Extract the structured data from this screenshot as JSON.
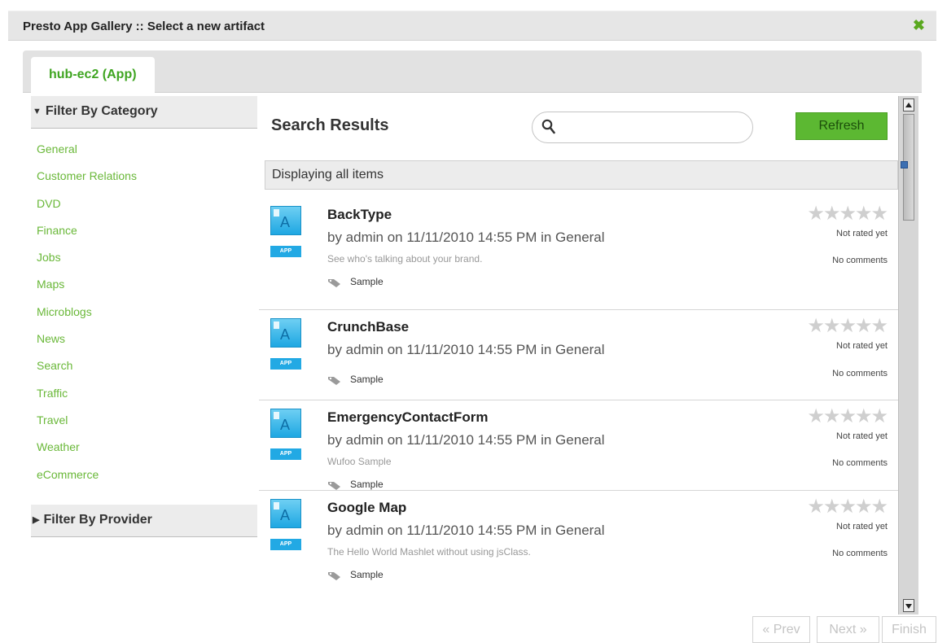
{
  "window": {
    "title": "Presto App Gallery :: Select a new artifact",
    "close_label": "✖"
  },
  "tabs": [
    {
      "label": "hub-ec2 (App)"
    }
  ],
  "sidebar": {
    "category_header": "Filter By Category",
    "categories": [
      "General",
      "Customer Relations",
      "DVD",
      "Finance",
      "Jobs",
      "Maps",
      "Microblogs",
      "News",
      "Search",
      "Traffic",
      "Travel",
      "Weather",
      "eCommerce"
    ],
    "provider_header": "Filter By Provider"
  },
  "main": {
    "results_title": "Search Results",
    "search": {
      "placeholder": "",
      "value": ""
    },
    "refresh_label": "Refresh",
    "displaying": "Displaying all items",
    "items": [
      {
        "name": "BackType",
        "meta": "by admin  on  11/11/2010 14:55 PM  in General",
        "description": "See who's talking about your brand.",
        "tag": "Sample",
        "badge": "APP",
        "icon_letter": "A",
        "rating_stars": "★★★★★",
        "rating_text": "Not rated yet",
        "comments": "No comments"
      },
      {
        "name": "CrunchBase",
        "meta": "by admin  on  11/11/2010 14:55 PM  in General",
        "description": "",
        "tag": "Sample",
        "badge": "APP",
        "icon_letter": "A",
        "rating_stars": "★★★★★",
        "rating_text": "Not rated yet",
        "comments": "No comments"
      },
      {
        "name": "EmergencyContactForm",
        "meta": "by admin  on  11/11/2010 14:55 PM  in General",
        "description": "Wufoo Sample",
        "tag": "Sample",
        "badge": "APP",
        "icon_letter": "A",
        "rating_stars": "★★★★★",
        "rating_text": "Not rated yet",
        "comments": "No comments"
      },
      {
        "name": "Google Map",
        "meta": "by admin  on  11/11/2010 14:55 PM  in General",
        "description": "The Hello World Mashlet without using jsClass.",
        "tag": "Sample",
        "badge": "APP",
        "icon_letter": "A",
        "rating_stars": "★★★★★",
        "rating_text": "Not rated yet",
        "comments": "No comments"
      }
    ]
  },
  "pager": {
    "prev_label": "« Prev",
    "next_label": "Next »",
    "finish_label": "Finish"
  },
  "icons": {
    "close": "close-icon",
    "search": "search-icon",
    "tag": "tag-icon",
    "app": "app-icon"
  },
  "colors": {
    "accent_green": "#5cb832",
    "link_green": "#6ab839",
    "app_blue": "#22a9e4"
  }
}
